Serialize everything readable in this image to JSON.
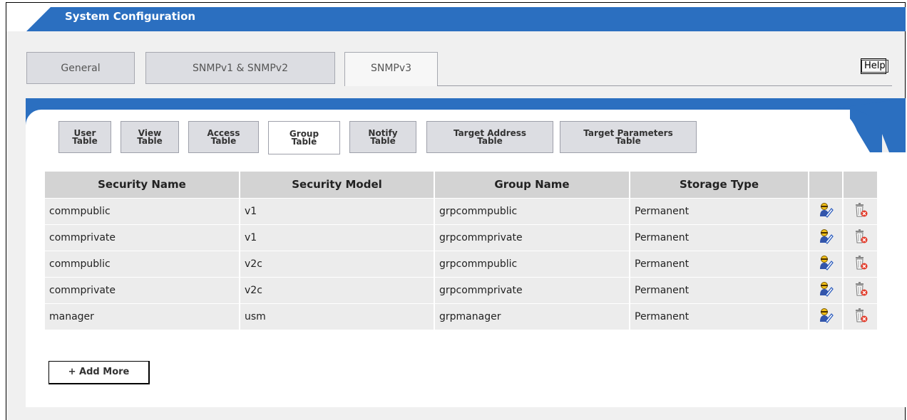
{
  "header": {
    "title": "System Configuration",
    "help_label": "Help"
  },
  "top_tabs": [
    "General",
    "SNMPv1 & SNMPv2",
    "SNMPv3"
  ],
  "sub_tabs": [
    "User\nTable",
    "View\nTable",
    "Access\nTable",
    "Group\nTable",
    "Notify\nTable",
    "Target Address\nTable",
    "Target Parameters\nTable"
  ],
  "table": {
    "columns": [
      "Security Name",
      "Security Model",
      "Group Name",
      "Storage Type"
    ],
    "rows": [
      [
        "commpublic",
        "v1",
        "grpcommpublic",
        "Permanent"
      ],
      [
        "commprivate",
        "v1",
        "grpcommprivate",
        "Permanent"
      ],
      [
        "commpublic",
        "v2c",
        "grpcommpublic",
        "Permanent"
      ],
      [
        "commprivate",
        "v2c",
        "grpcommprivate",
        "Permanent"
      ],
      [
        "manager",
        "usm",
        "grpmanager",
        "Permanent"
      ]
    ]
  },
  "add_more_label": "+ Add More",
  "colors": {
    "accent": "#2b6fc0",
    "header_bg": "#d3d3d3",
    "row_bg": "#ececec"
  },
  "icons": {
    "edit": "edit-user-icon",
    "delete": "trash-delete-icon"
  }
}
